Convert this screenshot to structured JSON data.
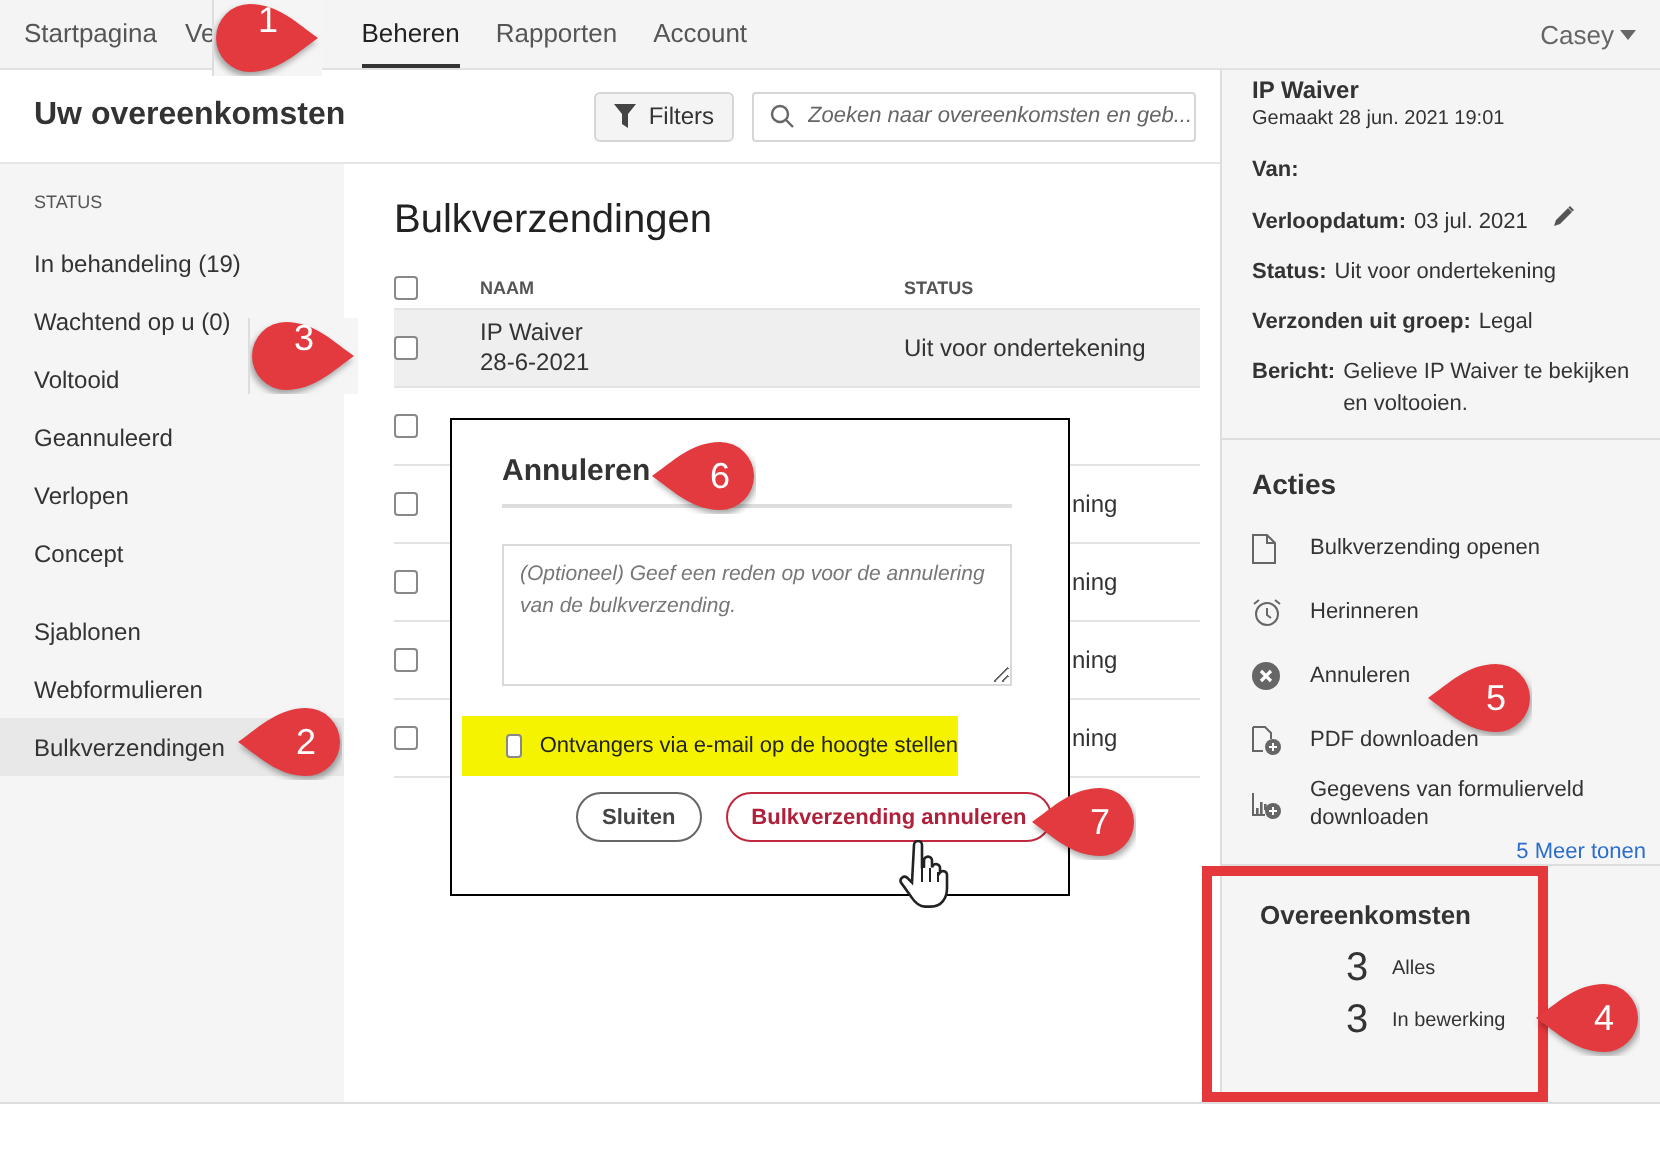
{
  "nav": {
    "items": [
      {
        "label": "Startpagina",
        "selected": false
      },
      {
        "label": "Ve",
        "selected": false
      },
      {
        "label": "Beheren",
        "selected": true
      },
      {
        "label": "Rapporten",
        "selected": false
      },
      {
        "label": "Account",
        "selected": false
      }
    ],
    "user": "Casey"
  },
  "header": {
    "title": "Uw overeenkomsten",
    "filters": "Filters",
    "search": {
      "placeholder": "Zoeken naar overeenkomsten en geb..."
    }
  },
  "sidebar": {
    "heading": "STATUS",
    "sections": [
      {
        "items": [
          {
            "label": "In behandeling (19)",
            "selected": false
          },
          {
            "label": "Wachtend op u (0)",
            "selected": false
          },
          {
            "label": "Voltooid",
            "selected": false
          },
          {
            "label": "Geannuleerd",
            "selected": false
          },
          {
            "label": "Verlopen",
            "selected": false
          },
          {
            "label": "Concept",
            "selected": false
          }
        ]
      },
      {
        "items": [
          {
            "label": "Sjablonen",
            "selected": false
          },
          {
            "label": "Webformulieren",
            "selected": false
          },
          {
            "label": "Bulkverzendingen",
            "selected": true
          }
        ]
      }
    ]
  },
  "main": {
    "title": "Bulkverzendingen",
    "table": {
      "columns": [
        "NAAM",
        "STATUS"
      ],
      "all_checked": false,
      "rows": [
        {
          "name": "IP Waiver",
          "date": "28-6-2021",
          "status": "Uit voor ondertekening",
          "checked": false,
          "selected": true
        },
        {
          "checked": false,
          "selected": false
        },
        {
          "status": "ning",
          "checked": false,
          "selected": false
        },
        {
          "status": "ning",
          "checked": false,
          "selected": false
        },
        {
          "status": "ning",
          "checked": false,
          "selected": false
        },
        {
          "status": "ning",
          "checked": false,
          "selected": false
        }
      ]
    }
  },
  "dialog": {
    "title": "Annuleren",
    "reason": {
      "placeholder": "(Optioneel) Geef een reden op voor de annulering van de bulkverzending."
    },
    "notify": {
      "label": "Ontvangers via e-mail op de hoogte stellen",
      "checked": false,
      "highlighted": true
    },
    "buttons": [
      {
        "label": "Sluiten",
        "kind": "secondary"
      },
      {
        "label": "Bulkverzending annuleren",
        "kind": "danger"
      }
    ]
  },
  "details": {
    "title": "IP Waiver",
    "created": "Gemaakt 28 jun. 2021 19:01",
    "fields": [
      {
        "label": "Van:"
      },
      {
        "label": "Verloopdatum:",
        "value": "03 jul. 2021",
        "editable": true
      },
      {
        "label": "Status:",
        "value": "Uit voor ondertekening"
      },
      {
        "label": "Verzonden uit groep:",
        "value": "Legal"
      },
      {
        "label": "Bericht:",
        "value": "Gelieve IP Waiver te bekijken en voltooien."
      }
    ]
  },
  "actions": {
    "title": "Acties",
    "items": [
      "Bulkverzending openen",
      "Herinneren",
      "Annuleren",
      "PDF downloaden",
      "Gegevens van formulierveld downloaden"
    ],
    "more": "5 Meer tonen"
  },
  "counts": {
    "title": "Overeenkomsten",
    "highlighted": true,
    "rows": [
      {
        "count": "3",
        "label": "Alles"
      },
      {
        "count": "3",
        "label": "In bewerking"
      }
    ]
  },
  "callouts": [
    {
      "number": "1",
      "kind": "right"
    },
    {
      "number": "2",
      "kind": "left"
    },
    {
      "number": "3",
      "kind": "right"
    },
    {
      "number": "4",
      "kind": "left"
    },
    {
      "number": "5",
      "kind": "left"
    },
    {
      "number": "6",
      "kind": "left"
    },
    {
      "number": "7",
      "kind": "left"
    }
  ]
}
